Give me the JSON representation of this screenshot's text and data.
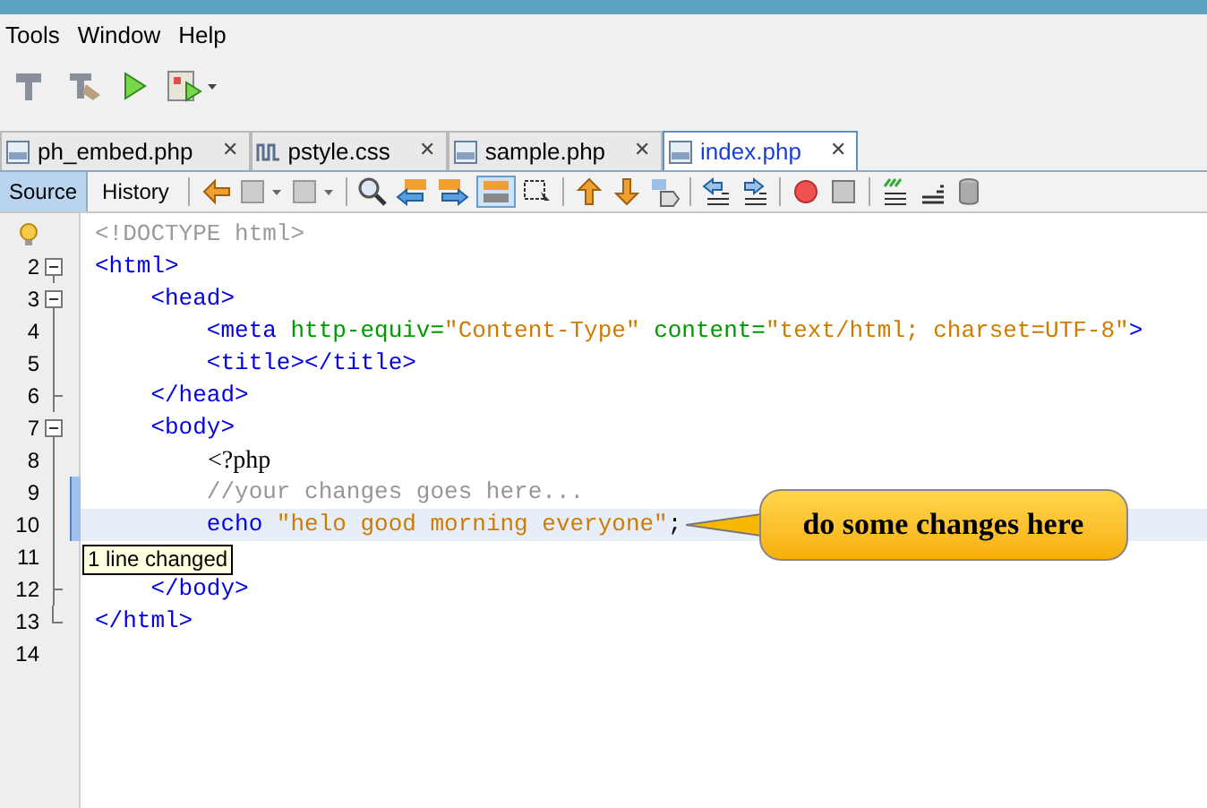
{
  "menu": [
    "Tools",
    "Window",
    "Help"
  ],
  "file_tabs": [
    {
      "label": "ph_embed.php",
      "kind": "php",
      "selected": false
    },
    {
      "label": "pstyle.css",
      "kind": "css",
      "selected": false
    },
    {
      "label": "sample.php",
      "kind": "php",
      "selected": false
    },
    {
      "label": "index.php",
      "kind": "php",
      "selected": true
    }
  ],
  "close_glyph": "✕",
  "view_tabs": [
    {
      "label": "Source",
      "selected": true
    },
    {
      "label": "History",
      "selected": false
    }
  ],
  "lines": [
    {
      "hint": true,
      "kind": "none",
      "changed": false,
      "current": false,
      "tokens": [
        {
          "kind": "doctype",
          "text": "<!DOCTYPE html>"
        }
      ]
    },
    {
      "number": "2",
      "hint": false,
      "kind": "open",
      "changed": false,
      "current": false,
      "tokens": [
        {
          "kind": "tag",
          "text": "<html>"
        }
      ]
    },
    {
      "number": "3",
      "hint": false,
      "kind": "open",
      "changed": false,
      "current": false,
      "tokens": [
        {
          "kind": "tag",
          "text": "    <head>"
        }
      ]
    },
    {
      "number": "4",
      "hint": false,
      "kind": "line",
      "changed": false,
      "current": false,
      "tokens": [
        {
          "kind": "tag",
          "text": "        <meta "
        },
        {
          "kind": "attr",
          "text": "http-equiv="
        },
        {
          "kind": "str",
          "text": "\"Content-Type\" "
        },
        {
          "kind": "attr",
          "text": "content="
        },
        {
          "kind": "str",
          "text": "\"text/html; charset=UTF-8\""
        },
        {
          "kind": "tag",
          "text": ">"
        }
      ]
    },
    {
      "number": "5",
      "hint": false,
      "kind": "line",
      "changed": false,
      "current": false,
      "tokens": [
        {
          "kind": "tag",
          "text": "        <title></title>"
        }
      ]
    },
    {
      "number": "6",
      "hint": false,
      "kind": "end",
      "changed": false,
      "current": false,
      "tokens": [
        {
          "kind": "tag",
          "text": "    </head>"
        }
      ]
    },
    {
      "number": "7",
      "hint": false,
      "kind": "open",
      "changed": false,
      "current": false,
      "tokens": [
        {
          "kind": "tag",
          "text": "    <body>"
        }
      ]
    },
    {
      "number": "8",
      "hint": false,
      "kind": "line",
      "changed": false,
      "current": false,
      "tokens": [
        {
          "kind": "php",
          "text": "<?php"
        }
      ]
    },
    {
      "number": "9",
      "hint": false,
      "kind": "line",
      "changed": true,
      "current": false,
      "tokens": [
        {
          "kind": "comment",
          "text": "        //your changes goes here..."
        }
      ]
    },
    {
      "number": "10",
      "hint": false,
      "kind": "line",
      "changed": true,
      "current": true,
      "tokens": [
        {
          "kind": "tag",
          "text": "        echo "
        },
        {
          "kind": "str",
          "text": "\"helo good morning everyone\""
        },
        {
          "kind": "plain",
          "text": ";"
        }
      ]
    },
    {
      "number": "11",
      "hint": false,
      "kind": "line",
      "changed": false,
      "current": false
    },
    {
      "number": "12",
      "hint": false,
      "kind": "end",
      "changed": false,
      "current": false,
      "tokens": [
        {
          "kind": "tag",
          "text": "    </body>"
        }
      ]
    },
    {
      "number": "13",
      "hint": false,
      "kind": "last",
      "changed": false,
      "current": false,
      "tokens": [
        {
          "kind": "tag",
          "text": "</html>"
        }
      ]
    },
    {
      "number": "14",
      "hint": false,
      "kind": "none",
      "changed": false,
      "current": false
    }
  ],
  "tooltip": "1 line changed",
  "callout": "do some changes here"
}
